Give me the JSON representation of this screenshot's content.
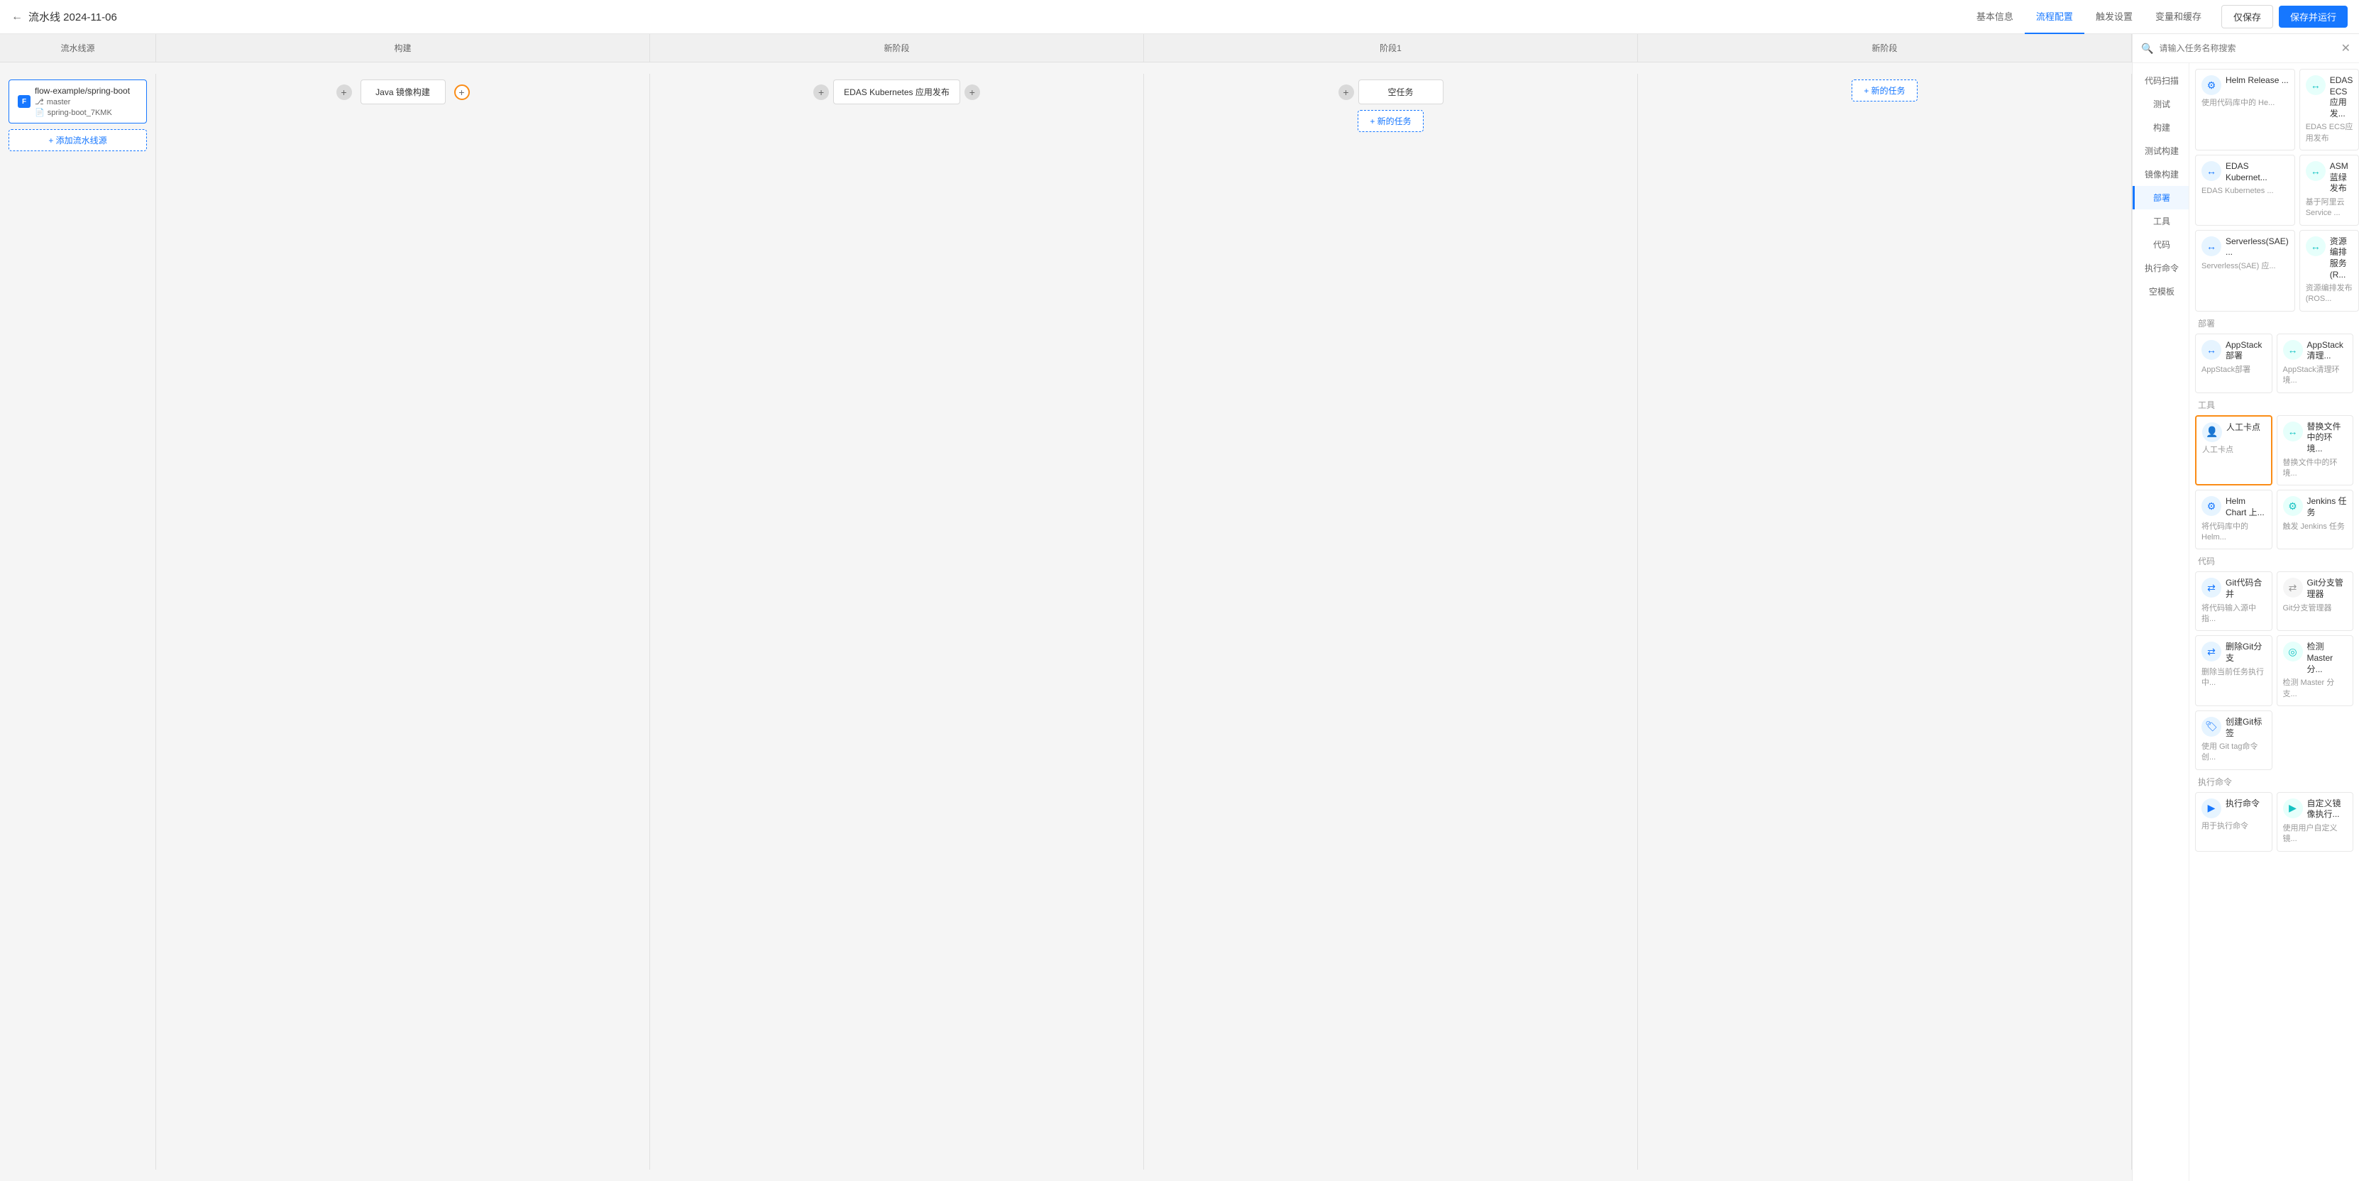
{
  "topNav": {
    "backLabel": "←",
    "title": "流水线 2024-11-06",
    "tabs": [
      {
        "id": "basic",
        "label": "基本信息",
        "active": false
      },
      {
        "id": "flow",
        "label": "流程配置",
        "active": true
      },
      {
        "id": "trigger",
        "label": "触发设置",
        "active": false
      },
      {
        "id": "vars",
        "label": "变量和缓存",
        "active": false
      }
    ],
    "saveLabel": "仅保存",
    "saveRunLabel": "保存并运行"
  },
  "stageHeaders": [
    {
      "id": "source",
      "label": "流水线源"
    },
    {
      "id": "build",
      "label": "构建"
    },
    {
      "id": "stage0",
      "label": "新阶段"
    },
    {
      "id": "stage1",
      "label": "阶段1"
    },
    {
      "id": "stage2",
      "label": "新阶段"
    }
  ],
  "source": {
    "label": "流水线源",
    "item": {
      "icon": "F",
      "name": "flow-example/spring-boot",
      "branch": "master",
      "file": "spring-boot_7KMK"
    },
    "addLabel": "+ 添加流水线源"
  },
  "stages": [
    {
      "id": "build",
      "tasks": [
        {
          "id": "java-build",
          "label": "Java 镜像构建",
          "connLeft": "gray",
          "connRight": "orange"
        }
      ]
    },
    {
      "id": "stage0",
      "tasks": [
        {
          "id": "edas-k8s",
          "label": "EDAS Kubernetes 应用发布",
          "connLeft": "gray",
          "connRight": "gray"
        }
      ]
    },
    {
      "id": "stage1",
      "tasks": [
        {
          "id": "empty-task",
          "label": "空任务",
          "connLeft": "gray",
          "connRight": null
        }
      ],
      "addNewLabel": "+ 新的任务"
    },
    {
      "id": "stage2",
      "tasks": [],
      "addNewLabel": "+ 新的任务"
    }
  ],
  "rightSidebar": {
    "searchPlaceholder": "请输入任务名称搜索",
    "closeIcon": "✕",
    "navItems": [
      {
        "id": "code-scan",
        "label": "代码扫描",
        "active": false
      },
      {
        "id": "test",
        "label": "测试",
        "active": false
      },
      {
        "id": "build",
        "label": "构建",
        "active": false
      },
      {
        "id": "test-build",
        "label": "测试构建",
        "active": false
      },
      {
        "id": "image-build",
        "label": "镜像构建",
        "active": false
      },
      {
        "id": "deploy",
        "label": "部署",
        "active": true
      },
      {
        "id": "tool",
        "label": "工具",
        "active": false
      },
      {
        "id": "code",
        "label": "代码",
        "active": false
      },
      {
        "id": "exec-cmd",
        "label": "执行命令",
        "active": false
      },
      {
        "id": "template",
        "label": "空模板",
        "active": false
      }
    ],
    "sections": [
      {
        "title": "",
        "tools": [
          {
            "id": "helm-release",
            "icon": "⚙",
            "iconStyle": "blue",
            "name": "Helm Release ...",
            "desc": "使用代码库中的 He..."
          },
          {
            "id": "edas-ecs",
            "icon": "↔",
            "iconStyle": "cyan",
            "name": "EDAS ECS应用发...",
            "desc": "EDAS ECS应用发布"
          },
          {
            "id": "edas-kubernetes",
            "icon": "↔",
            "iconStyle": "blue",
            "name": "EDAS Kubernet...",
            "desc": "EDAS Kubernetes ..."
          },
          {
            "id": "asm-bluegreen",
            "icon": "↔",
            "iconStyle": "cyan",
            "name": "ASM 蓝绿发布",
            "desc": "基于阿里云Service ..."
          },
          {
            "id": "serverless-sae",
            "icon": "↔",
            "iconStyle": "blue",
            "name": "Serverless(SAE) ...",
            "desc": "Serverless(SAE) 应..."
          },
          {
            "id": "resource-orchestration",
            "icon": "↔",
            "iconStyle": "cyan",
            "name": "资源编排服务(R...",
            "desc": "资源编排发布(ROS..."
          }
        ]
      },
      {
        "title": "部署",
        "tools": [
          {
            "id": "appstack-deploy",
            "icon": "↔",
            "iconStyle": "blue",
            "name": "AppStack部署",
            "desc": "AppStack部署"
          },
          {
            "id": "appstack-clean",
            "icon": "↔",
            "iconStyle": "cyan",
            "name": "AppStack清理...",
            "desc": "AppStack清理环境..."
          }
        ]
      },
      {
        "title": "工具",
        "tools": [
          {
            "id": "manual-checkpoint",
            "icon": "👤",
            "iconStyle": "blue",
            "name": "人工卡点",
            "desc": "人工卡点",
            "highlighted": true
          },
          {
            "id": "convert-file-env",
            "icon": "↔",
            "iconStyle": "cyan",
            "name": "替换文件中的环境...",
            "desc": "替换文件中的环境..."
          },
          {
            "id": "helm-chart-upload",
            "icon": "⚙",
            "iconStyle": "blue",
            "name": "Helm Chart 上...",
            "desc": "将代码库中的 Helm..."
          },
          {
            "id": "jenkins-task",
            "icon": "⚙",
            "iconStyle": "cyan",
            "name": "Jenkins 任务",
            "desc": "触发 Jenkins 任务"
          }
        ]
      },
      {
        "title": "代码",
        "tools": [
          {
            "id": "git-merge",
            "icon": "⇄",
            "iconStyle": "blue",
            "name": "Git代码合并",
            "desc": "将代码输入源中指..."
          },
          {
            "id": "git-branch-mgr",
            "icon": "⇄",
            "iconStyle": "gray",
            "name": "Git分支管理器",
            "desc": "Git分支管理器"
          },
          {
            "id": "delete-git-branch",
            "icon": "⇄",
            "iconStyle": "blue",
            "name": "删除Git分支",
            "desc": "删除当前任务执行中..."
          },
          {
            "id": "check-master",
            "icon": "◎",
            "iconStyle": "cyan",
            "name": "检测 Master 分...",
            "desc": "检测 Master 分支..."
          },
          {
            "id": "create-git-tag",
            "icon": "🏷",
            "iconStyle": "blue",
            "name": "创建Git标签",
            "desc": "使用 Git tag命令创..."
          }
        ]
      },
      {
        "title": "执行命令",
        "tools": [
          {
            "id": "exec-command",
            "icon": "▶",
            "iconStyle": "blue",
            "name": "执行命令",
            "desc": "用于执行命令"
          },
          {
            "id": "custom-mirror-exec",
            "icon": "▶",
            "iconStyle": "cyan",
            "name": "自定义镜像执行...",
            "desc": "使用用户自定义镜..."
          }
        ]
      }
    ]
  }
}
